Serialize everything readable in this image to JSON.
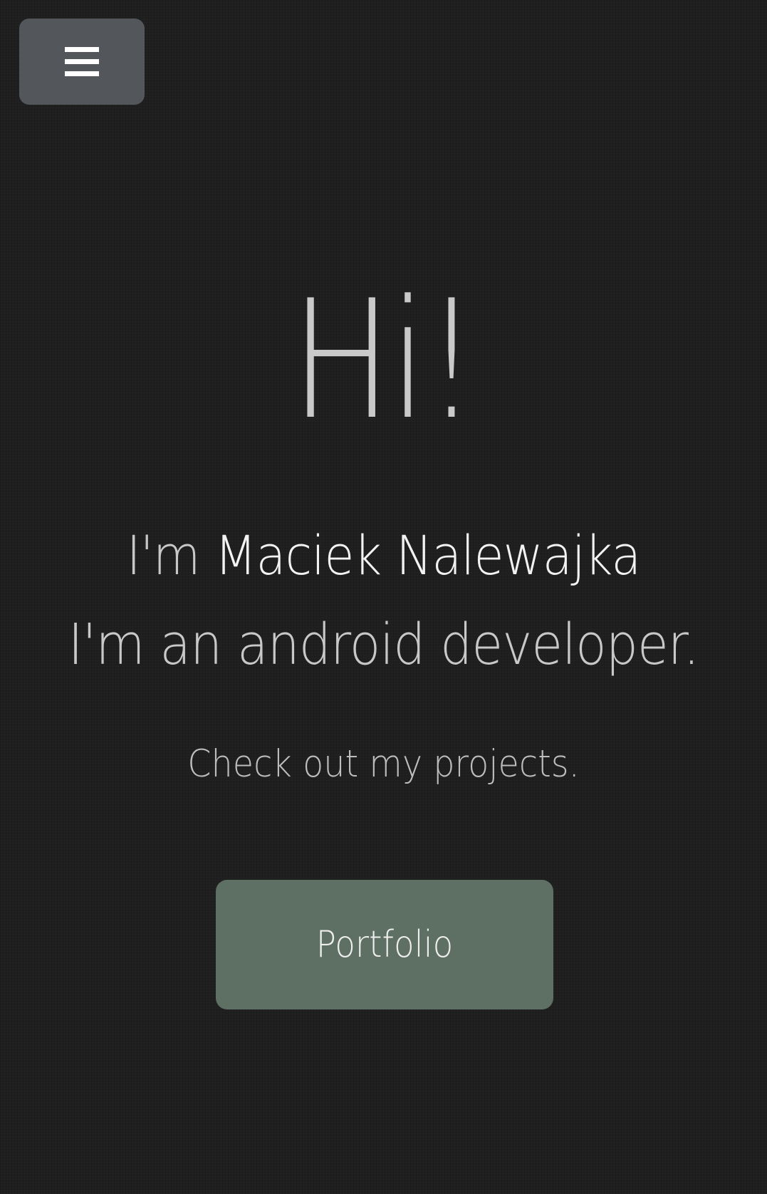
{
  "nav": {
    "menu_icon": "hamburger-menu-icon",
    "menu_button_color": "#53565b"
  },
  "hero": {
    "greeting": "Hi!",
    "intro_prefix": "I'm ",
    "name": "Maciek Nalewajka",
    "role": "I'm an android developer.",
    "cta_text": "Check out my projects.",
    "portfolio_label": "Portfolio"
  },
  "colors": {
    "background": "#1f1f1f",
    "accent_button": "#5e6f63",
    "text": "#c8c8c8",
    "highlight_text": "#f2f2f2"
  }
}
